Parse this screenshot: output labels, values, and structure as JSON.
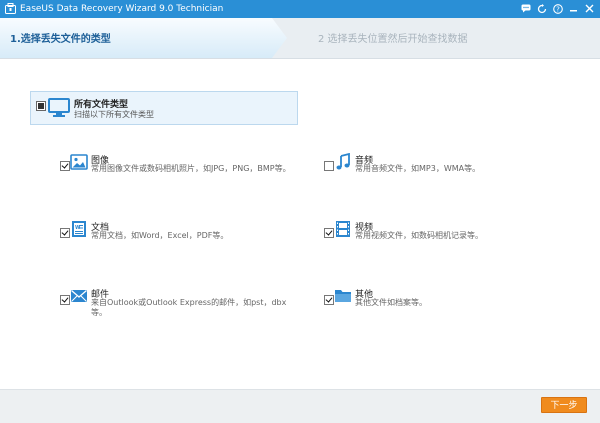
{
  "window": {
    "title": "EaseUS Data Recovery Wizard 9.0 Technician"
  },
  "steps": {
    "step1": "1.选择丢失文件的类型",
    "step2": "2 选择丢失位置然后开始查找数据"
  },
  "all_types": {
    "title": "所有文件类型",
    "subtitle": "扫描以下所有文件类型"
  },
  "options": {
    "image": {
      "label": "图像",
      "desc": "常用图像文件或数码相机照片，如JPG，PNG，BMP等。",
      "checked": true
    },
    "audio": {
      "label": "音频",
      "desc": "常用音频文件，如MP3，WMA等。",
      "checked": false
    },
    "document": {
      "label": "文档",
      "desc": "常用文档，如Word，Excel，PDF等。",
      "checked": true
    },
    "video": {
      "label": "视频",
      "desc": "常用视频文件，如数码相机记录等。",
      "checked": true
    },
    "email": {
      "label": "邮件",
      "desc": "来自Outlook或Outlook Express的邮件，如pst，dbx等。",
      "checked": true
    },
    "other": {
      "label": "其他",
      "desc": "其他文件如档案等。",
      "checked": true
    }
  },
  "footer": {
    "next_label": "下一步"
  },
  "colors": {
    "titlebar": "#2a8fd6",
    "accent": "#1d5f98",
    "next_button": "#f08b1e",
    "icon_blue": "#2b86cf"
  }
}
